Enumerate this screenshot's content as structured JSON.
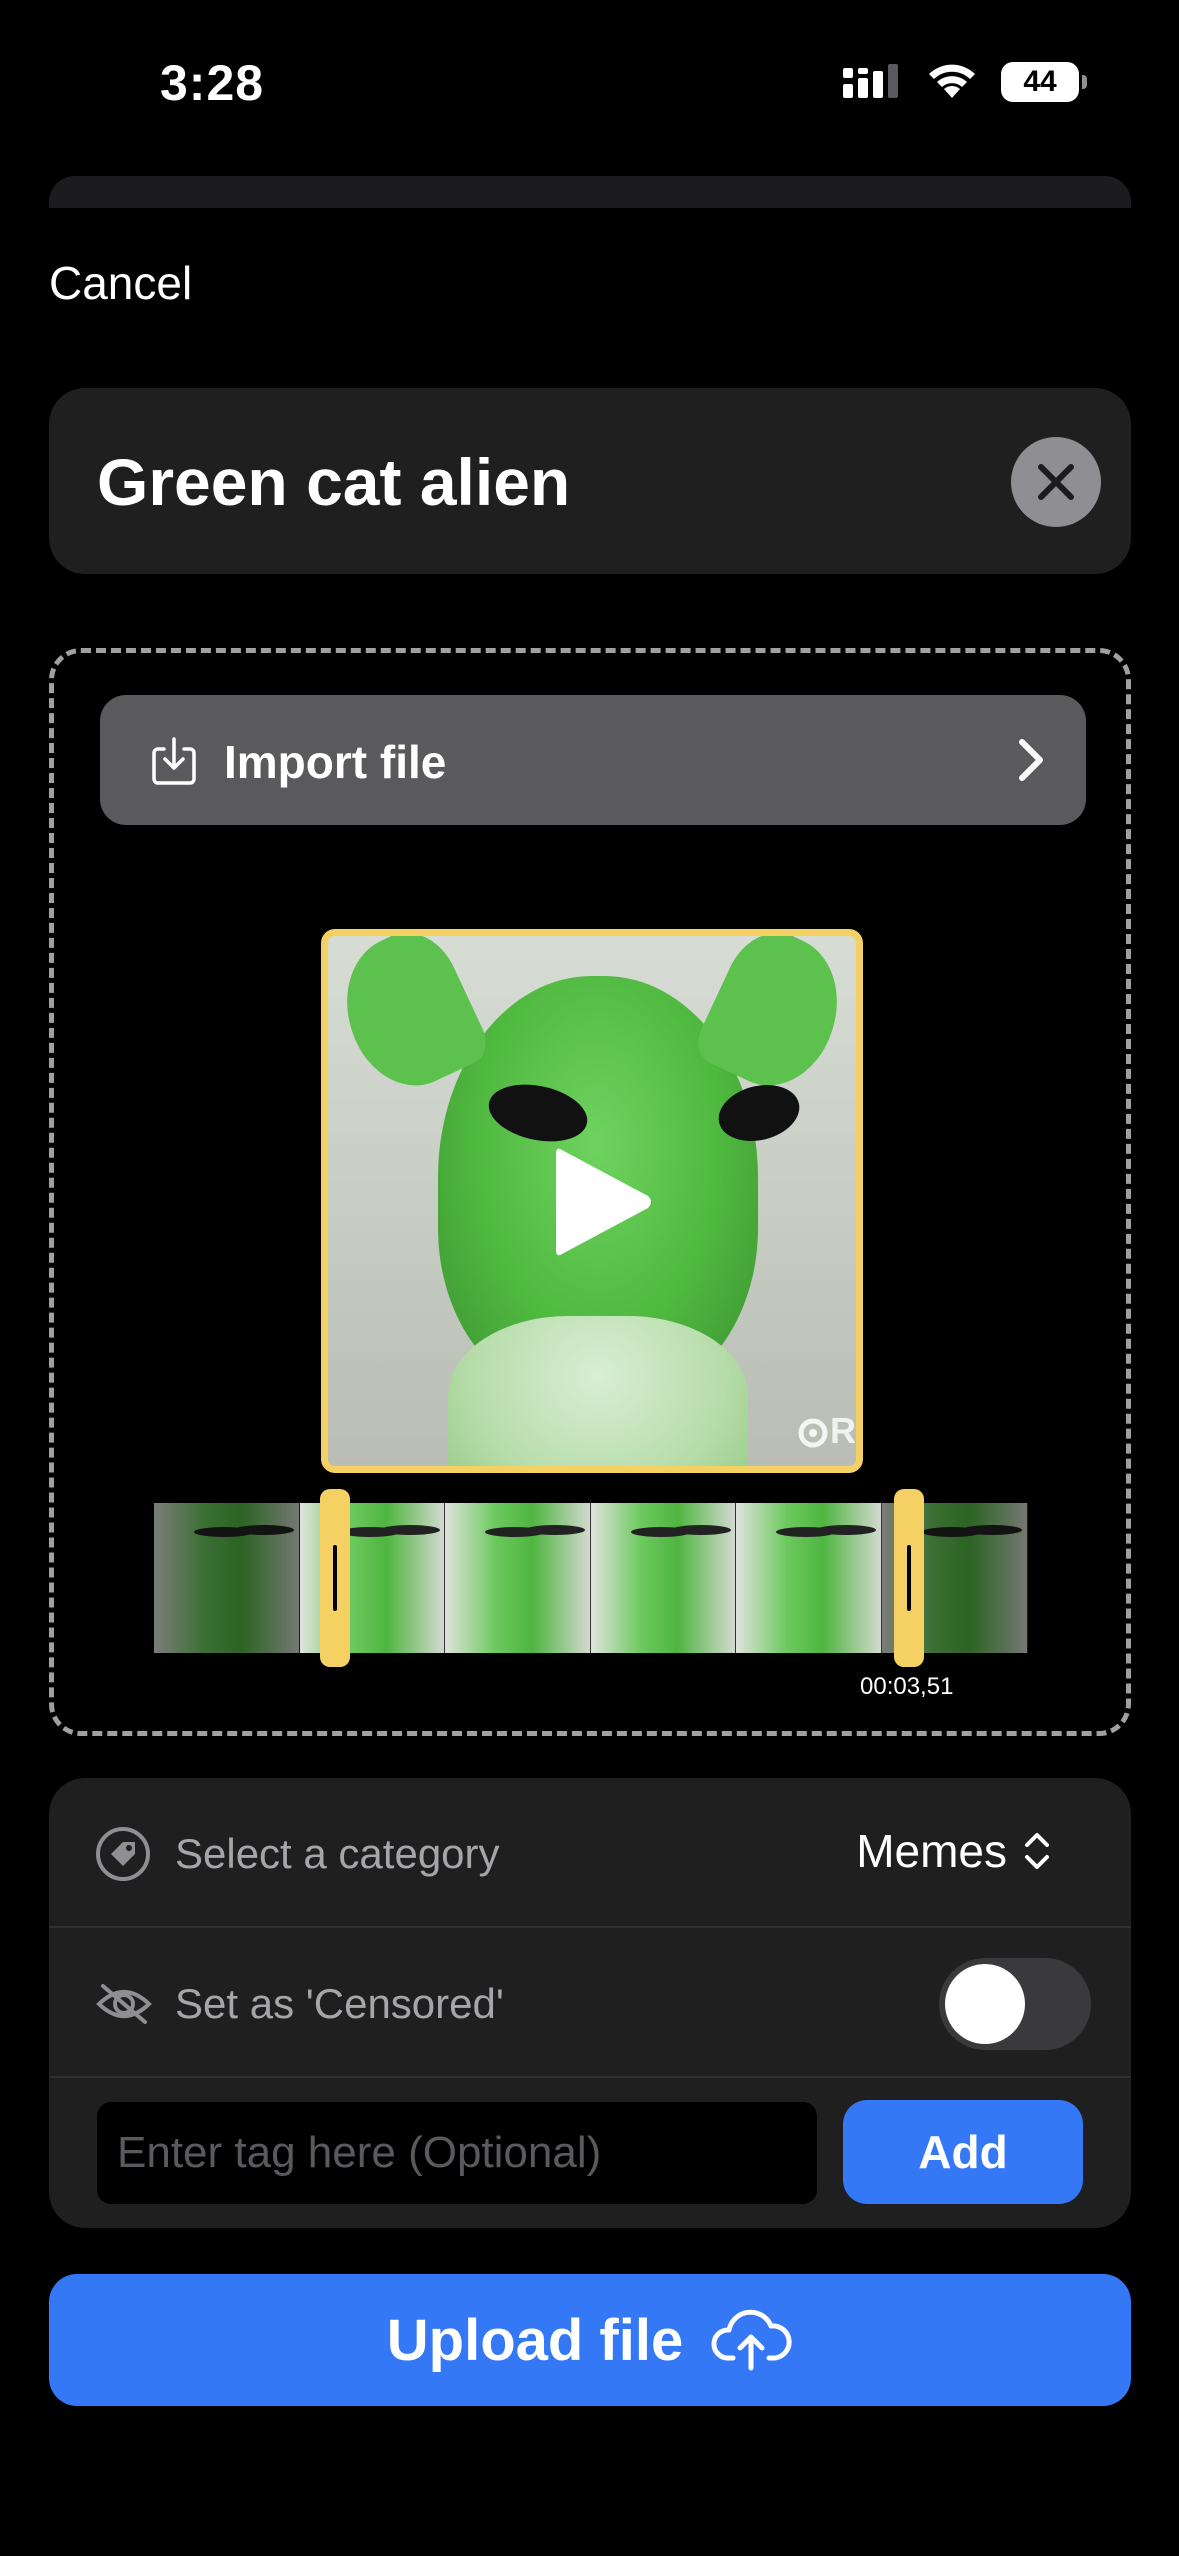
{
  "status_bar": {
    "time": "3:28",
    "battery": "44"
  },
  "header": {
    "cancel_label": "Cancel"
  },
  "title_field": {
    "value": "Green cat alien"
  },
  "media": {
    "import_label": "Import file",
    "watermark": "R",
    "trim_end_time": "00:03,51"
  },
  "options": {
    "category_label": "Select a category",
    "category_value": "Memes",
    "censored_label": "Set as 'Censored'",
    "censored_on": false,
    "tag_placeholder": "Enter tag here (Optional)",
    "tag_value": "",
    "add_label": "Add"
  },
  "upload": {
    "label": "Upload file"
  },
  "colors": {
    "accent": "#3478f6",
    "trim": "#f5d164",
    "card": "#1f1f1f"
  }
}
